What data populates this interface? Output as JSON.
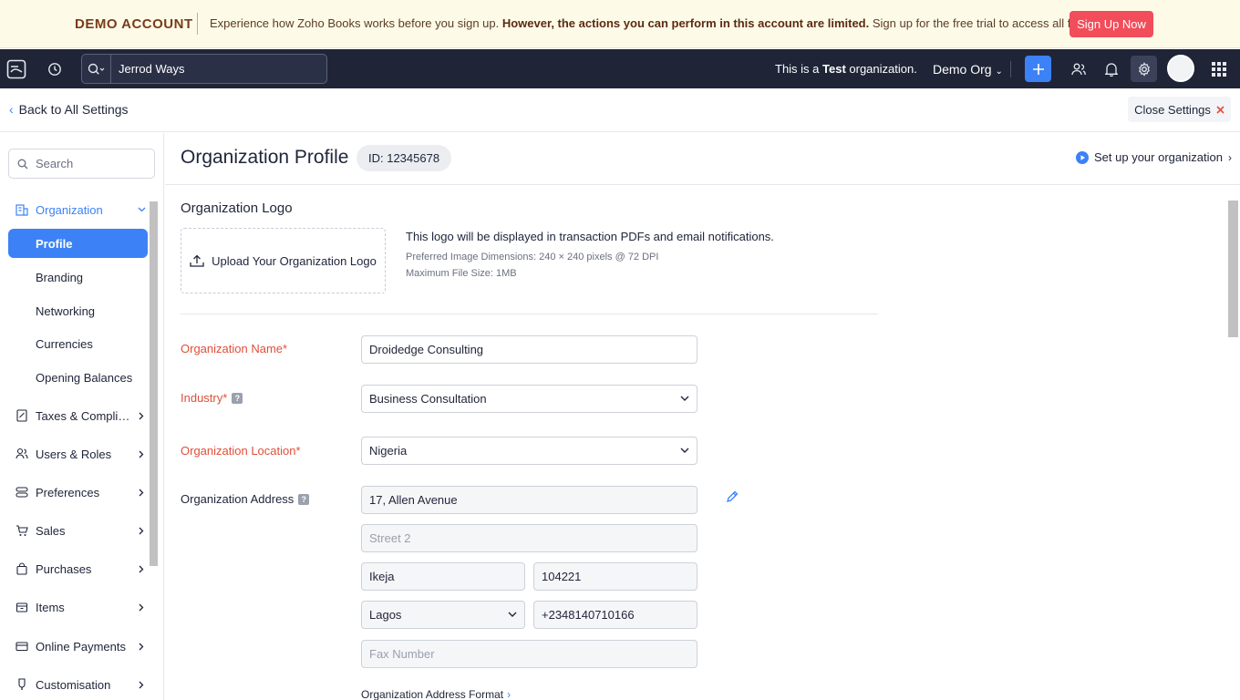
{
  "banner": {
    "title": "DEMO ACCOUNT",
    "text_before": "Experience how Zoho Books works before you sign up. ",
    "text_bold": "However, the actions you can perform in this account are limited.",
    "text_after": " Sign up for the free trial to access all features.",
    "signup_label": "Sign Up Now"
  },
  "topnav": {
    "search_value": "Jerrod Ways",
    "test_prefix": "This is a ",
    "test_bold": "Test",
    "test_suffix": " organization.",
    "org_name": "Demo Org"
  },
  "settings": {
    "back_label": "Back to All Settings",
    "close_label": "Close Settings"
  },
  "sidebar": {
    "search_placeholder": "Search",
    "groups": [
      {
        "label": "Organization",
        "icon": "building-icon"
      },
      {
        "label": "Taxes & Complian...",
        "icon": "tax-icon"
      },
      {
        "label": "Users & Roles",
        "icon": "users-icon"
      },
      {
        "label": "Preferences",
        "icon": "preferences-icon"
      },
      {
        "label": "Sales",
        "icon": "cart-icon"
      },
      {
        "label": "Purchases",
        "icon": "bag-icon"
      },
      {
        "label": "Items",
        "icon": "box-icon"
      },
      {
        "label": "Online Payments",
        "icon": "card-icon"
      },
      {
        "label": "Customisation",
        "icon": "brush-icon"
      }
    ],
    "org_items": [
      "Profile",
      "Branding",
      "Networking",
      "Currencies",
      "Opening Balances"
    ]
  },
  "main": {
    "title": "Organization Profile",
    "id_badge": "ID: 12345678",
    "setup_link": "Set up your organization",
    "logo_section": "Organization Logo",
    "upload_label": "Upload Your Organization Logo",
    "logo_info": "This logo will be displayed in transaction PDFs and email notifications.",
    "logo_dims": "Preferred Image Dimensions: 240 × 240 pixels @ 72 DPI",
    "logo_size": "Maximum File Size: 1MB",
    "org_name_label": "Organization Name*",
    "org_name_value": "Droidedge Consulting",
    "industry_label": "Industry*",
    "industry_value": "Business Consultation",
    "location_label": "Organization Location*",
    "location_value": "Nigeria",
    "address_label": "Organization Address",
    "street1": "17, Allen Avenue",
    "street2_placeholder": "Street 2",
    "city": "Ikeja",
    "zip": "104221",
    "state": "Lagos",
    "phone": "+2348140710166",
    "fax_placeholder": "Fax Number",
    "address_format_link": "Organization Address Format"
  },
  "colors": {
    "accent": "#3c82f6",
    "nav_bg": "#1f2437",
    "required": "#e04f39",
    "signup": "#f24d5a"
  }
}
